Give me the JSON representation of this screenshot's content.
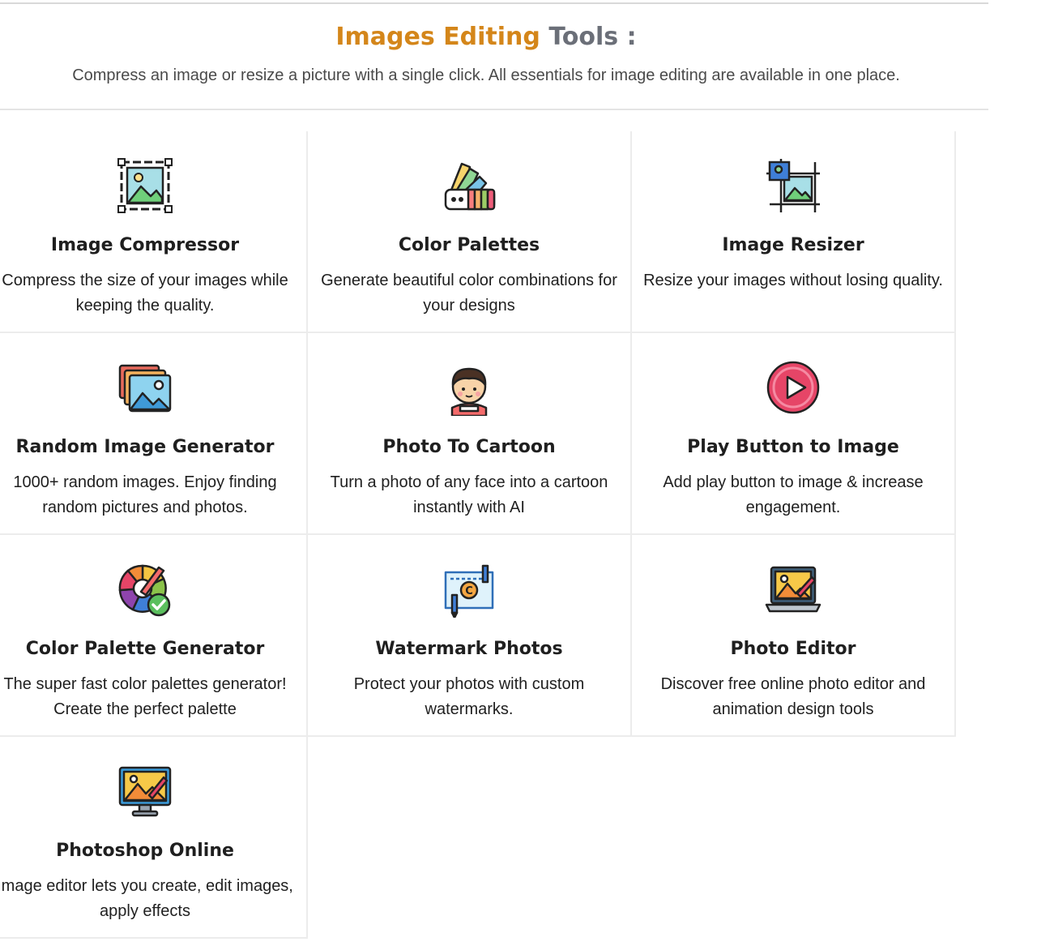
{
  "header": {
    "title_part1": "Images Editing",
    "title_part2": "Tools :",
    "subtitle": "Compress an image or resize a picture with a single click. All essentials for image editing are available in one place."
  },
  "colors": {
    "title_accent": "#d4861a",
    "title_rest": "#6b6f78",
    "text": "#1f1f1f"
  },
  "tools": [
    {
      "title": "Image Compressor",
      "description": "Compress the size of your images while keeping the quality.",
      "icon": "image-compress-icon"
    },
    {
      "title": "Color Palettes",
      "description": "Generate beautiful color combinations for your designs",
      "icon": "color-swatch-icon"
    },
    {
      "title": "Image Resizer",
      "description": "Resize your images without losing quality.",
      "icon": "image-resize-icon"
    },
    {
      "title": "Random Image Generator",
      "description": "1000+ random images. Enjoy finding random pictures and photos.",
      "icon": "stacked-images-icon"
    },
    {
      "title": "Photo To Cartoon",
      "description": "Turn a photo of any face into a cartoon instantly with AI",
      "icon": "cartoon-face-icon"
    },
    {
      "title": "Play Button to Image",
      "description": "Add play button to image & increase engagement.",
      "icon": "play-button-icon"
    },
    {
      "title": "Color Palette Generator",
      "description": "The super fast color palettes generator! Create the perfect palette",
      "icon": "color-wheel-icon"
    },
    {
      "title": "Watermark Photos",
      "description": "Protect your photos with custom watermarks.",
      "icon": "watermark-icon"
    },
    {
      "title": "Photo Editor",
      "description": "Discover free online photo editor and animation design tools",
      "icon": "laptop-photo-icon"
    },
    {
      "title": "Photoshop Online",
      "description": "Image editor lets you create, edit images, apply effects",
      "icon": "monitor-photo-icon"
    }
  ]
}
